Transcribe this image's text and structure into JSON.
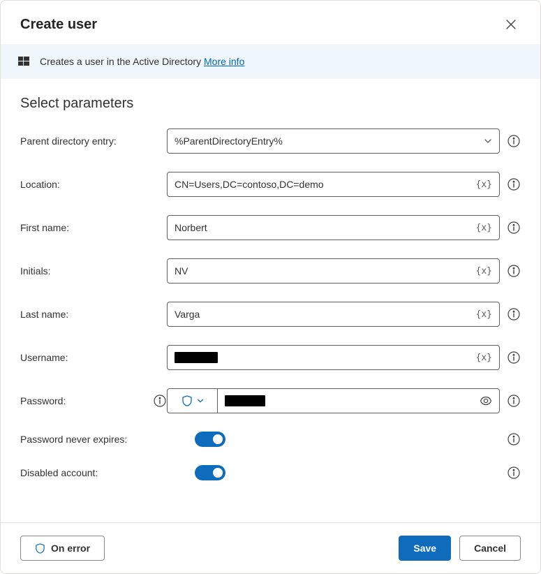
{
  "dialog": {
    "title": "Create user"
  },
  "banner": {
    "text": "Creates a user in the Active Directory",
    "moreInfo": "More info"
  },
  "section": {
    "title": "Select parameters"
  },
  "fields": {
    "parentDirectory": {
      "label": "Parent directory entry:",
      "value": "%ParentDirectoryEntry%"
    },
    "location": {
      "label": "Location:",
      "value": "CN=Users,DC=contoso,DC=demo",
      "varBadge": "{x}"
    },
    "firstName": {
      "label": "First name:",
      "value": "Norbert",
      "varBadge": "{x}"
    },
    "initials": {
      "label": "Initials:",
      "value": "NV",
      "varBadge": "{x}"
    },
    "lastName": {
      "label": "Last name:",
      "value": "Varga",
      "varBadge": "{x}"
    },
    "username": {
      "label": "Username:",
      "value": "",
      "varBadge": "{x}"
    },
    "password": {
      "label": "Password:",
      "value": ""
    },
    "passwordNeverExpires": {
      "label": "Password never expires:",
      "value": true
    },
    "disabledAccount": {
      "label": "Disabled account:",
      "value": true
    }
  },
  "footer": {
    "onError": "On error",
    "save": "Save",
    "cancel": "Cancel"
  }
}
